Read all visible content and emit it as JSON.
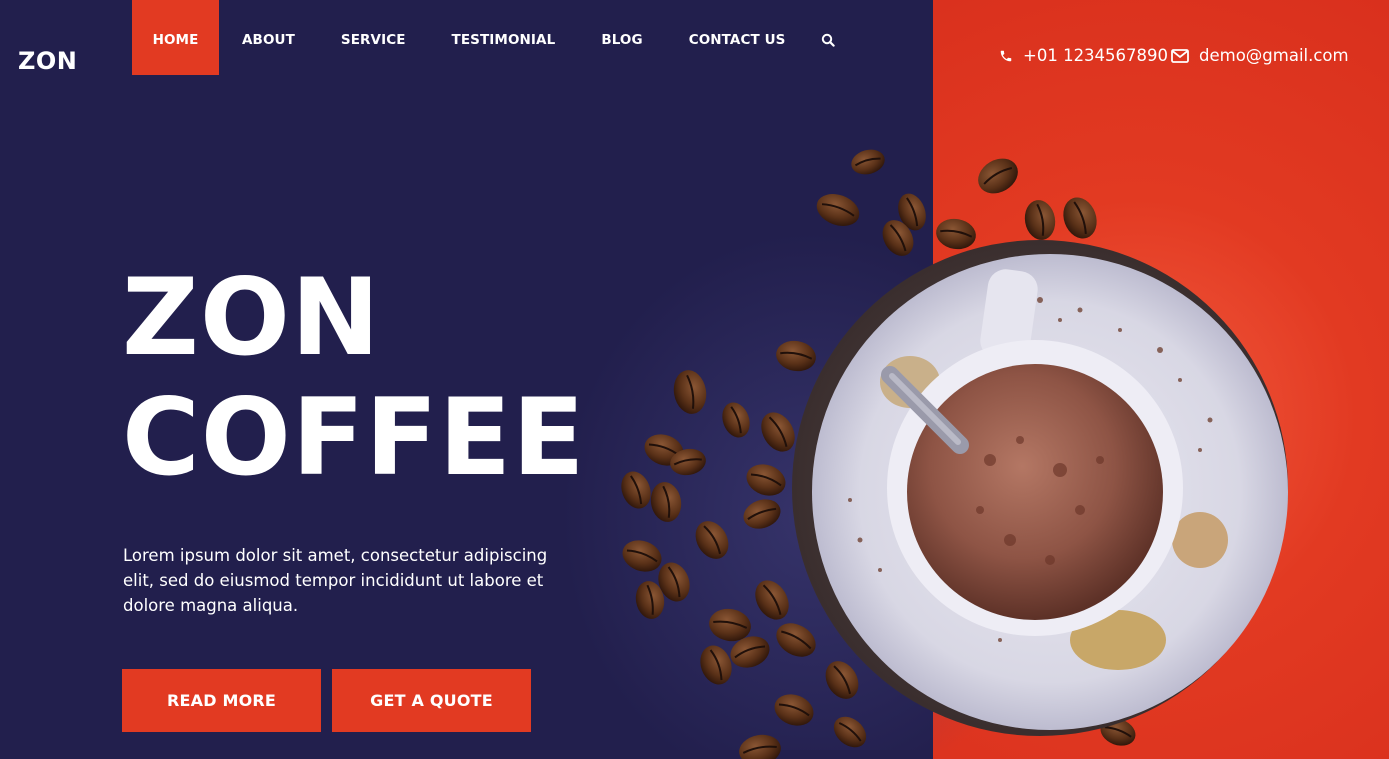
{
  "brand": {
    "logo": "ZON"
  },
  "nav": {
    "items": [
      {
        "label": "HOME",
        "active": true
      },
      {
        "label": "ABOUT"
      },
      {
        "label": "SERVICE"
      },
      {
        "label": "TESTIMONIAL"
      },
      {
        "label": "BLOG"
      },
      {
        "label": "CONTACT US"
      }
    ],
    "search_icon": "search-icon"
  },
  "contact": {
    "phone": "+01 1234567890",
    "phone_icon": "phone-icon",
    "email": "demo@gmail.com",
    "email_icon": "envelope-icon"
  },
  "hero": {
    "title_line1": "ZON",
    "title_line2": "COFFEE",
    "description": "Lorem ipsum dolor sit amet, consectetur adipiscing elit, sed do eiusmod tempor incididunt ut labore et dolore magna aliqua.",
    "buttons": {
      "read_more": "READ MORE",
      "get_quote": "GET A QUOTE"
    },
    "image": "coffee-cup-with-beans"
  },
  "colors": {
    "navy": "#221f4d",
    "accent": "#e23a22",
    "text": "#ffffff"
  }
}
